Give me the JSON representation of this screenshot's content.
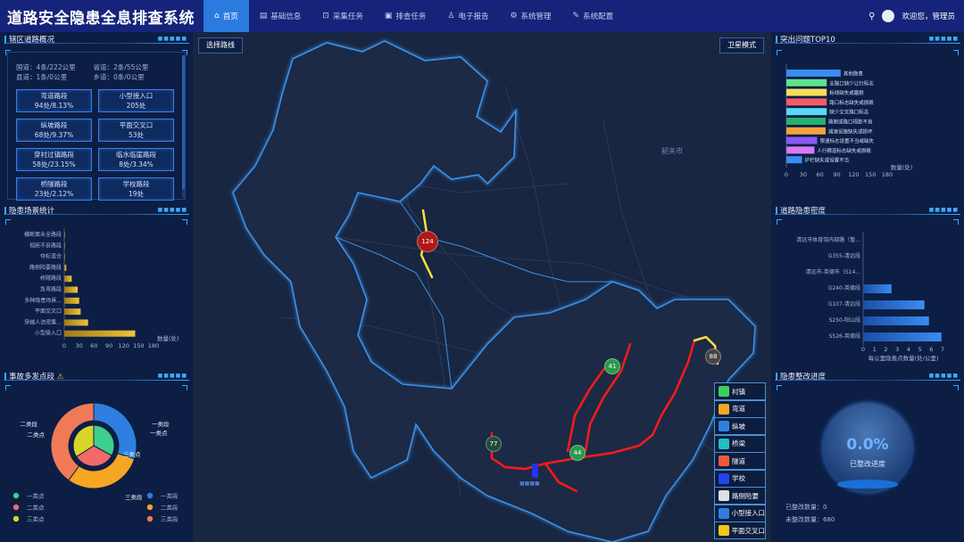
{
  "app": {
    "title": "道路安全隐患全息排查系统"
  },
  "nav": [
    {
      "label": "首页",
      "icon": "home-icon",
      "glyph": "⌂",
      "active": true
    },
    {
      "label": "基础信息",
      "icon": "database-icon",
      "glyph": "▤"
    },
    {
      "label": "采集任务",
      "icon": "cart-icon",
      "glyph": "⊡"
    },
    {
      "label": "排查任务",
      "icon": "clipboard-icon",
      "glyph": "▣"
    },
    {
      "label": "电子报告",
      "icon": "person-icon",
      "glyph": "♙"
    },
    {
      "label": "系统管理",
      "icon": "gear-icon",
      "glyph": "⚙"
    },
    {
      "label": "系统配置",
      "icon": "wrench-icon",
      "glyph": "✎"
    }
  ],
  "user": {
    "welcome": "欢迎您，管理员"
  },
  "road_overview": {
    "title": "辖区道路概况",
    "lines": [
      {
        "a": "国道：",
        "b": "4条/222公里",
        "c": "省道：",
        "d": "2条/55公里"
      },
      {
        "a": "县道：",
        "b": "1条/0公里",
        "c": "乡道：",
        "d": "0条/0公里"
      }
    ],
    "buttons": [
      {
        "label": "弯道路段",
        "value": "94处/8.13%"
      },
      {
        "label": "小型接入口",
        "value": "205处"
      },
      {
        "label": "纵坡路段",
        "value": "68处/9.37%"
      },
      {
        "label": "平面交叉口",
        "value": "53处"
      },
      {
        "label": "穿村过镇路段",
        "value": "58处/23.15%"
      },
      {
        "label": "临水临崖路段",
        "value": "8处/3.34%"
      },
      {
        "label": "桥隧路段",
        "value": "23处/2.12%"
      },
      {
        "label": "学校路段",
        "value": "19处"
      }
    ]
  },
  "hazard_scene": {
    "title": "隐患场景统计",
    "unit": "数量(处)",
    "chart_data": {
      "type": "bar",
      "orientation": "horizontal",
      "categories": [
        "横断面未全路段",
        "视距不良路段",
        "夺标混合",
        "路侧险要路段",
        "桥隧路段",
        "急弯路段",
        "多种隐患场景...",
        "平面交叉口",
        "穿越人流密集...",
        "小型接入口"
      ],
      "values": [
        0,
        0,
        0,
        4,
        15,
        27,
        30,
        33,
        48,
        143
      ],
      "xticks": [
        0,
        30,
        60,
        90,
        120,
        150,
        180
      ],
      "xlim": [
        0,
        180
      ],
      "xlabel": "数量(处)",
      "colors": [
        "#f0c33a",
        "#a07a1a"
      ]
    }
  },
  "accident_points": {
    "title": "事故多发点段",
    "chart_data": {
      "type": "pie",
      "outer": [
        {
          "name": "一类段",
          "value": 30,
          "color": "#2e7fe0"
        },
        {
          "name": "二类段",
          "value": 30,
          "color": "#f5a623"
        },
        {
          "name": "三类段",
          "value": 40,
          "color": "#f07a57"
        }
      ],
      "inner": [
        {
          "name": "一类点",
          "value": 33,
          "color": "#3ccf8e"
        },
        {
          "name": "二类点",
          "value": 33,
          "color": "#f06a6a"
        },
        {
          "name": "三类点",
          "value": 34,
          "color": "#d7d52b"
        }
      ]
    },
    "callouts": [
      "二类段",
      "一类段",
      "三类点",
      "一类点",
      "二类点",
      "三类段"
    ],
    "legend": [
      {
        "name": "一类点",
        "color": "#3ccf8e"
      },
      {
        "name": "一类段",
        "color": "#2e7fe0"
      },
      {
        "name": "二类点",
        "color": "#f06a6a"
      },
      {
        "name": "二类段",
        "color": "#f5a623"
      },
      {
        "name": "三类点",
        "color": "#d7d52b"
      },
      {
        "name": "三类段",
        "color": "#f07a57"
      }
    ]
  },
  "map": {
    "route_button": "选择路线",
    "satellite_button": "卫星模式",
    "city_label": "韶关市",
    "markers": [
      {
        "value": "124",
        "color": "#b01818"
      },
      {
        "value": "41",
        "color": "#2a9a4a"
      },
      {
        "value": "88",
        "color": "#444444"
      },
      {
        "value": "77",
        "color": "#234a3a"
      },
      {
        "value": "44",
        "color": "#2a9a4a"
      }
    ],
    "legend": [
      {
        "label": "村镇",
        "icon": "village-icon",
        "color": "#3ccf5a"
      },
      {
        "label": "弯道",
        "icon": "curve-icon",
        "color": "#f5a623"
      },
      {
        "label": "纵坡",
        "icon": "slope-icon",
        "color": "#2e7fe0"
      },
      {
        "label": "桥梁",
        "icon": "bridge-icon",
        "color": "#20c0c0"
      },
      {
        "label": "隧道",
        "icon": "tunnel-icon",
        "color": "#f05a3a"
      },
      {
        "label": "学校",
        "icon": "school-icon",
        "color": "#2244ee"
      },
      {
        "label": "路侧险要",
        "icon": "roadside-icon",
        "color": "#e0e0e0"
      },
      {
        "label": "小型接入口",
        "icon": "access-icon",
        "color": "#2e7fe0"
      },
      {
        "label": "平面交叉口",
        "icon": "crossing-icon",
        "color": "#f5c518"
      }
    ]
  },
  "top_issues": {
    "title": "突出问题TOP10",
    "chart_data": {
      "type": "bar",
      "orientation": "horizontal",
      "categories": [
        "其他隐患",
        "支路口缺少让行标志",
        "标线缺失或磨损",
        "路口标志缺失或损毁",
        "缺少交叉路口标志",
        "路侧或路口视距不良",
        "减速设施缺失或损坏",
        "限速标志设置不当或缺失",
        "人行横道标志缺失或损毁",
        "护栏缺失或设置不当"
      ],
      "values": [
        97,
        72,
        72,
        72,
        72,
        70,
        70,
        55,
        50,
        28
      ],
      "colors": [
        "#3a8cf0",
        "#5de28a",
        "#f5dd5a",
        "#f55a6a",
        "#5ad8f5",
        "#26b070",
        "#f5a33a",
        "#8a5af0",
        "#d87af5",
        "#3a8cf0"
      ],
      "xticks": [
        0,
        30,
        60,
        90,
        120,
        150,
        180
      ],
      "xlim": [
        0,
        180
      ],
      "xlabel": "数量(处)"
    }
  },
  "road_density": {
    "title": "道路隐患密度",
    "chart_data": {
      "type": "bar",
      "orientation": "horizontal",
      "categories": [
        "清远市体育馆内部路（暂...",
        "G355-清远段",
        "清远市-英德市（S14...",
        "G240-英德段",
        "G107-清远段",
        "S250-阳山段",
        "S526-英德段"
      ],
      "values": [
        0,
        0,
        0,
        2.5,
        5.4,
        5.8,
        6.9
      ],
      "xticks": [
        0,
        1,
        2,
        3,
        4,
        5,
        6,
        7
      ],
      "xlim": [
        0,
        7
      ],
      "xlabel": "每公里隐患点数量(处/公里)"
    }
  },
  "rectify": {
    "title": "隐患整改进度",
    "percent": "0.0%",
    "label": "已整改进度",
    "done_label": "已整改数量：",
    "done_value": "0",
    "todo_label": "未整改数量：",
    "todo_value": "680"
  }
}
